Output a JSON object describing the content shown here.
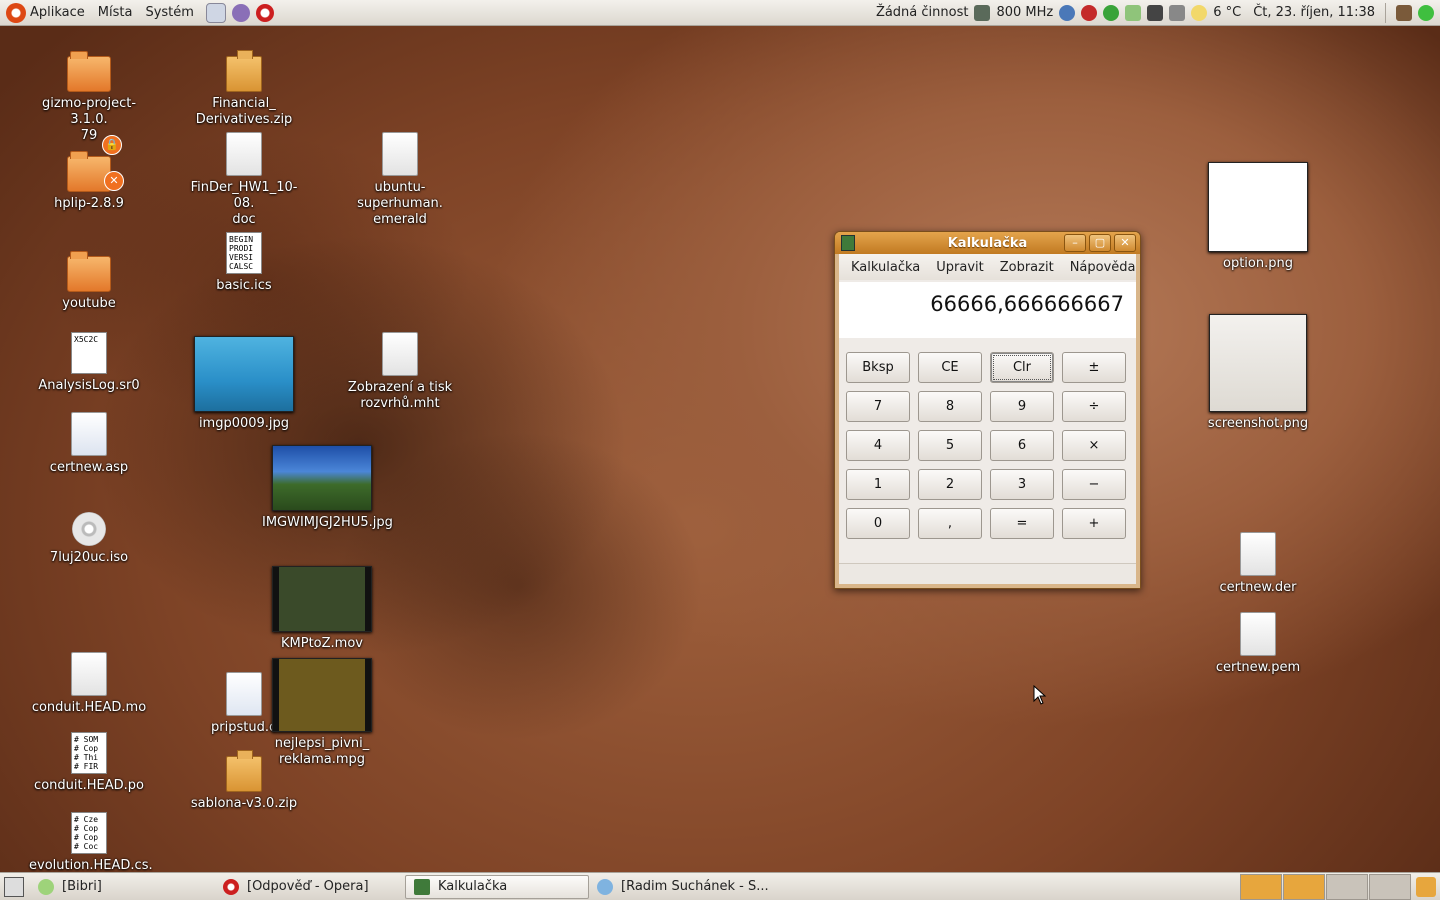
{
  "top_panel": {
    "menus": [
      "Aplikace",
      "Místa",
      "Systém"
    ],
    "status_text": "Žádná činnost",
    "cpu_freq": "800 MHz",
    "weather": "6 °C",
    "datetime": "Čt, 23. říjen, 11:38"
  },
  "desktop_icons": [
    {
      "name": "folder-icon",
      "label": "gizmo-project-3.1.0.79",
      "label_lines": [
        "gizmo-project-3.1.0.",
        "79"
      ]
    },
    {
      "name": "zip-icon",
      "label_lines": [
        "Financial_",
        "Derivatives.zip"
      ]
    },
    {
      "name": "folder-icon",
      "label_lines": [
        "hplip-2.8.9"
      ]
    },
    {
      "name": "doc-icon",
      "label_lines": [
        "FinDer_HW1_10-08.",
        "doc"
      ]
    },
    {
      "name": "text-file-icon",
      "label_lines": [
        "ubuntu-superhuman.",
        "emerald"
      ]
    },
    {
      "name": "text-file-icon",
      "label_lines": [
        "basic.ics"
      ],
      "preview": "BEGIN\nPRODI\nVERSI\nCALSC"
    },
    {
      "name": "folder-icon",
      "label_lines": [
        "youtube"
      ]
    },
    {
      "name": "text-file-icon",
      "label_lines": [
        "AnalysisLog.sr0"
      ],
      "preview": "X5C2C"
    },
    {
      "name": "image-thumbnail",
      "label_lines": [
        "imgp0009.jpg"
      ]
    },
    {
      "name": "text-file-icon",
      "label_lines": [
        "Zobrazení a tisk",
        "rozvrhů.mht"
      ]
    },
    {
      "name": "script-file-icon",
      "label_lines": [
        "certnew.asp"
      ]
    },
    {
      "name": "image-thumbnail",
      "label_lines": [
        "IMGWIMJGJ2HU5.jpg"
      ]
    },
    {
      "name": "disc-image-icon",
      "label_lines": [
        "7luj20uc.iso"
      ]
    },
    {
      "name": "video-thumbnail",
      "label_lines": [
        "KMPtoZ.mov"
      ]
    },
    {
      "name": "text-file-icon",
      "label_lines": [
        "conduit.HEAD.mo"
      ]
    },
    {
      "name": "document-icon",
      "label_lines": [
        "pripstud.o"
      ]
    },
    {
      "name": "video-thumbnail",
      "label_lines": [
        "nejlepsi_pivni_",
        "reklama.mpg"
      ]
    },
    {
      "name": "text-file-icon",
      "label_lines": [
        "conduit.HEAD.po"
      ],
      "preview": "# SOM\n# Cop\n# Thi\n# FIR"
    },
    {
      "name": "zip-icon",
      "label_lines": [
        "sablona-v3.0.zip"
      ]
    },
    {
      "name": "text-file-icon",
      "label_lines": [
        "evolution.HEAD.cs."
      ],
      "preview": "# Cze\n# Cop\n# Cop\n# Coc"
    },
    {
      "name": "image-thumbnail",
      "label_lines": [
        "option.png"
      ]
    },
    {
      "name": "image-thumbnail",
      "label_lines": [
        "screenshot.png"
      ]
    },
    {
      "name": "text-file-icon",
      "label_lines": [
        "certnew.der"
      ]
    },
    {
      "name": "text-file-icon",
      "label_lines": [
        "certnew.pem"
      ]
    }
  ],
  "calculator": {
    "title": "Kalkulačka",
    "menu": [
      "Kalkulačka",
      "Upravit",
      "Zobrazit",
      "Nápověda"
    ],
    "display_value": "66666,666666667",
    "keys": [
      [
        "Bksp",
        "CE",
        "Clr",
        "±"
      ],
      [
        "7",
        "8",
        "9",
        "÷"
      ],
      [
        "4",
        "5",
        "6",
        "×"
      ],
      [
        "1",
        "2",
        "3",
        "−"
      ],
      [
        "0",
        ",",
        "=",
        "+"
      ]
    ],
    "window_buttons": [
      "minimize",
      "maximize",
      "close"
    ]
  },
  "taskbar": {
    "tasks": [
      {
        "label": "[Bibri]"
      },
      {
        "label": "[Odpověď - Opera]"
      },
      {
        "label": "Kalkulačka",
        "active": true
      },
      {
        "label": "[Radim Suchánek - S..."
      }
    ]
  },
  "colors": {
    "accent": "#dd4814",
    "titlebar": "#c17a22",
    "panel": "#dcd7cf"
  }
}
